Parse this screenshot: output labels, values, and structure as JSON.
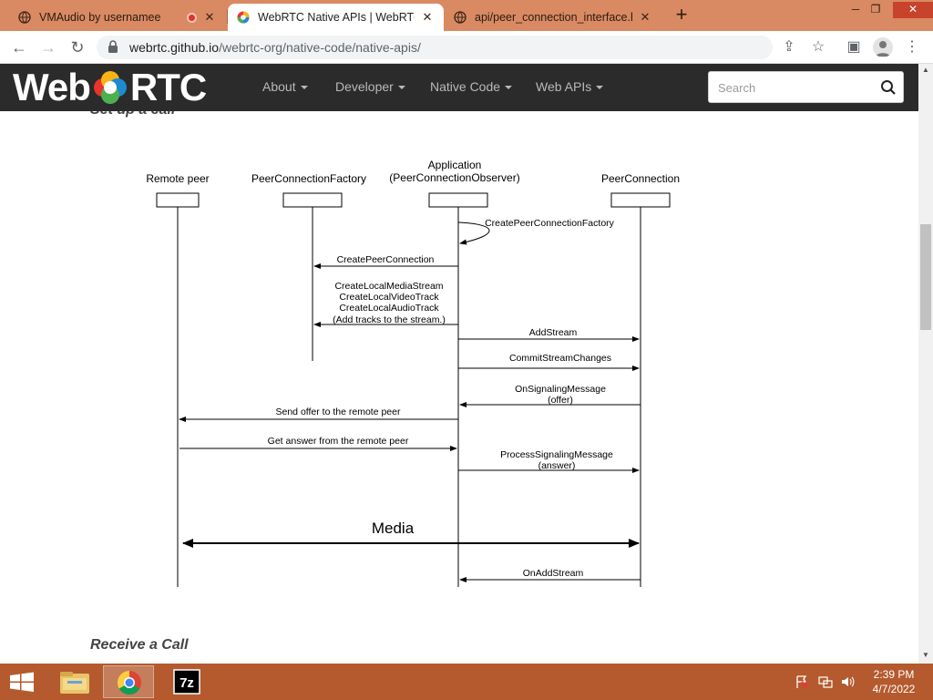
{
  "browser": {
    "tabs": [
      {
        "title": "VMAudio by usernamee",
        "active": false,
        "recording": true
      },
      {
        "title": "WebRTC Native APIs | WebRTC",
        "active": true
      },
      {
        "title": "api/peer_connection_interface.h",
        "active": false
      }
    ],
    "new_tab_label": "+",
    "url_host": "webrtc.github.io",
    "url_path": "/webrtc-org/native-code/native-apis/"
  },
  "site": {
    "logo_left": "Web",
    "logo_right": "RTC",
    "menu": [
      "About",
      "Developer",
      "Native Code",
      "Web APIs"
    ],
    "search_placeholder": "Search"
  },
  "content": {
    "section_top": "Set up a call",
    "section_bottom": "Receive a Call"
  },
  "diagram": {
    "lifelines": [
      "Remote peer",
      "PeerConnectionFactory",
      "Application",
      "(PeerConnectionObserver)",
      "PeerConnection"
    ],
    "messages": {
      "create_factory": "CreatePeerConnectionFactory",
      "create_pc": "CreatePeerConnection",
      "create_media_1": "CreateLocalMediaStream",
      "create_media_2": "CreateLocalVideoTrack",
      "create_media_3": "CreateLocalAudioTrack",
      "create_media_4": "(Add tracks to the stream.)",
      "add_stream": "AddStream",
      "commit": "CommitStreamChanges",
      "on_signaling_1": "OnSignalingMessage",
      "on_signaling_2": "(offer)",
      "send_offer": "Send offer to the remote peer",
      "get_answer": "Get answer from the remote peer",
      "process_1": "ProcessSignalingMessage",
      "process_2": "(answer)",
      "media": "Media",
      "on_add_stream": "OnAddStream"
    }
  },
  "taskbar": {
    "time": "2:39 PM",
    "date": "4/7/2022"
  },
  "colors": {
    "titlebar": "#d98a62",
    "taskbar": "#b45a2e",
    "site_header": "#2b2b2b"
  }
}
